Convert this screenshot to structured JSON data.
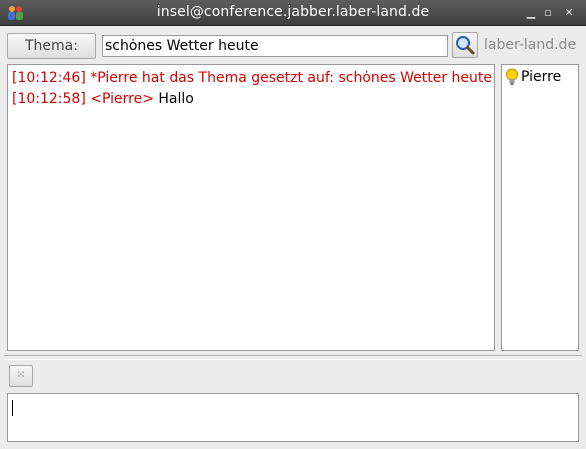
{
  "window": {
    "title": "insel@conference.jabber.laber-land.de",
    "icon": "group-chat-icon"
  },
  "topic": {
    "button_label": "Thema:",
    "value": "schȯnes Wetter heute",
    "search_icon": "magnifier-icon",
    "server": "laber-land.de"
  },
  "messages": [
    {
      "time": "[10:12:46]",
      "text": "*Pierre hat das Thema gesetzt auf: schȯnes Wetter heute",
      "color": "#d40000"
    },
    {
      "time": "[10:12:58]",
      "nick": "<Pierre>",
      "text": "Hallo",
      "color": "#d40000"
    }
  ],
  "roster": [
    {
      "name": "Pierre",
      "icon": "lightbulb-icon"
    }
  ],
  "composer": {
    "emoticon_icon": "emoticon-icon",
    "value": ""
  }
}
